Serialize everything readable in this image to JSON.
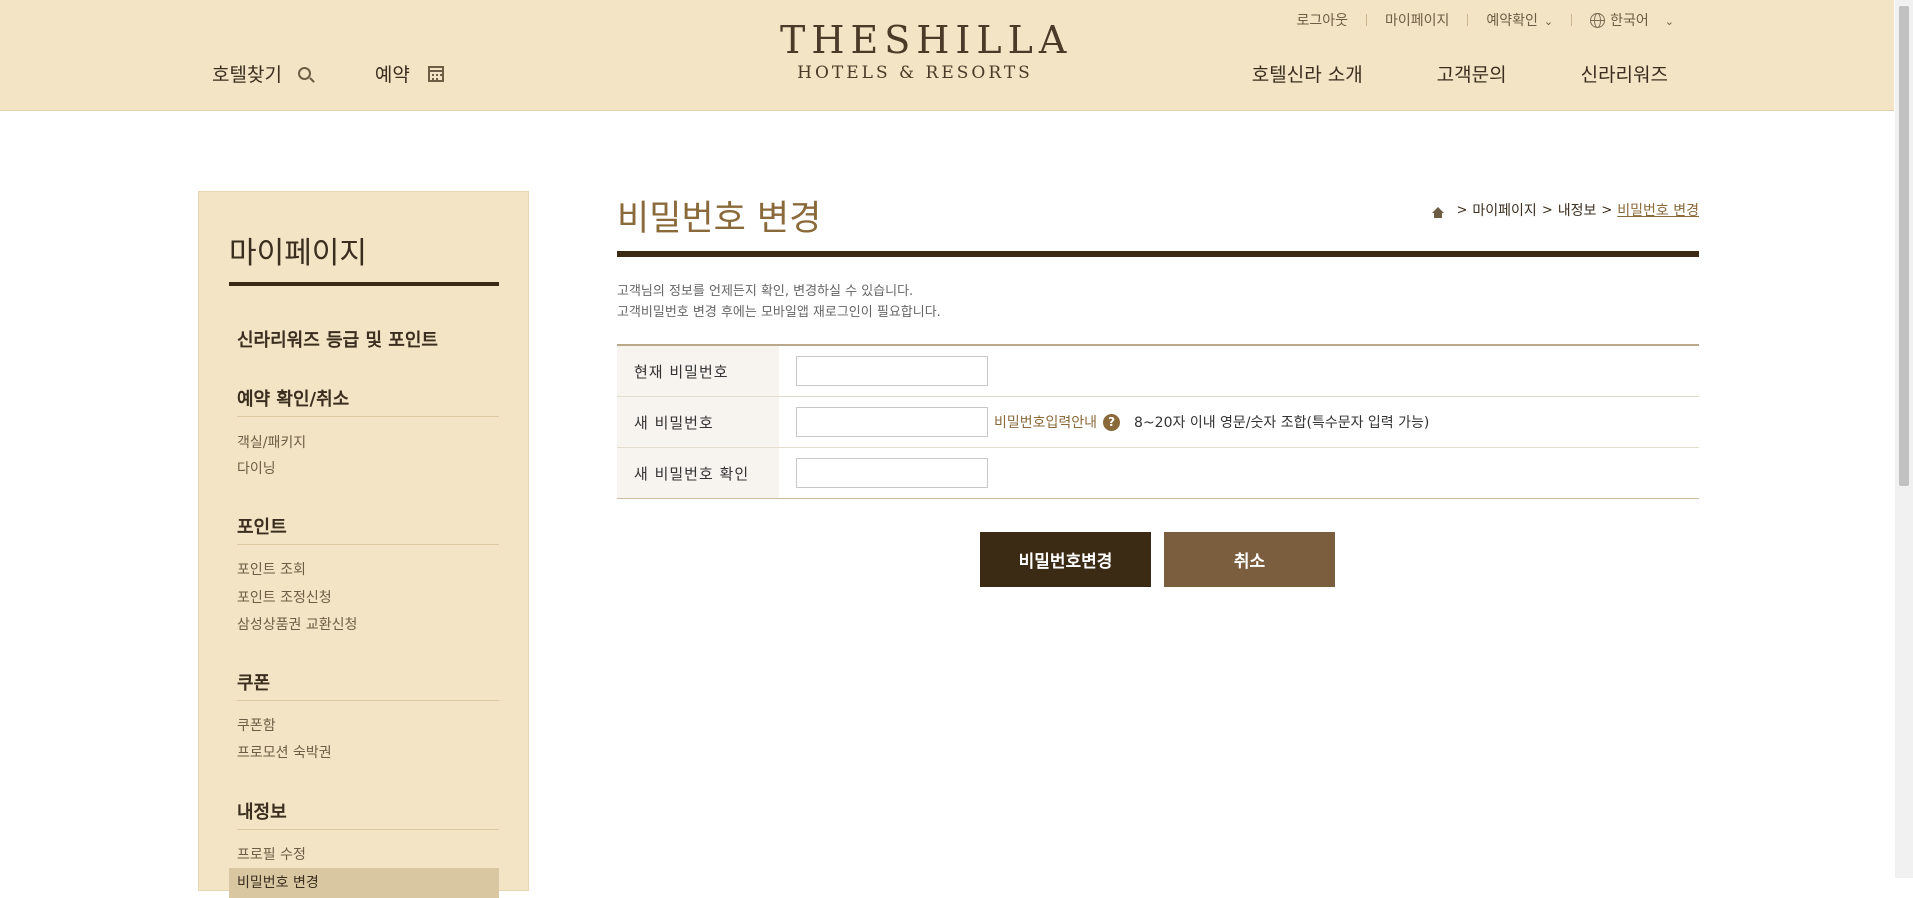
{
  "header": {
    "util": {
      "logout": "로그아웃",
      "mypage": "마이페이지",
      "reservation_check": "예약확인",
      "language": "한국어"
    },
    "nav_left": {
      "find_hotel": "호텔찾기",
      "reserve": "예약"
    },
    "logo": {
      "line1": "THESHILLA",
      "line2": "HOTELS & RESORTS"
    },
    "nav_right": [
      {
        "label": "호텔신라 소개"
      },
      {
        "label": "고객문의"
      },
      {
        "label": "신라리워즈"
      }
    ]
  },
  "sidebar": {
    "title": "마이페이지",
    "sections": [
      {
        "title": "신라리워즈 등급 및 포인트",
        "links": []
      },
      {
        "title": "예약 확인/취소",
        "links": [
          "객실/패키지",
          "다이닝"
        ]
      },
      {
        "title": "포인트",
        "links": [
          "포인트 조회",
          "포인트 조정신청",
          "삼성상품권 교환신청"
        ]
      },
      {
        "title": "쿠폰",
        "links": [
          "쿠폰함",
          "프로모션 숙박권"
        ]
      },
      {
        "title": "내정보",
        "links": [
          "프로필 수정",
          "비밀번호 변경"
        ]
      }
    ]
  },
  "main": {
    "title": "비밀번호 변경",
    "breadcrumb": [
      "마이페이지",
      "내정보",
      "비밀번호 변경"
    ],
    "description": [
      "고객님의 정보를 언제든지 확인, 변경하실 수 있습니다.",
      "고객비밀번호 변경 후에는 모바일앱 재로그인이 필요합니다."
    ],
    "form": {
      "current_password_label": "현재 비밀번호",
      "new_password_label": "새 비밀번호",
      "confirm_password_label": "새 비밀번호 확인",
      "guide_link": "비밀번호입력안내",
      "help_icon_glyph": "?",
      "guide_text": "8~20자 이내 영문/숫자 조합(특수문자 입력 가능)"
    },
    "buttons": {
      "submit": "비밀번호변경",
      "cancel": "취소"
    }
  },
  "colors": {
    "header_bg": "#f2e4c4",
    "dark_brown": "#3b2a14",
    "accent_brown": "#8a6a3a",
    "cancel_btn": "#7a5e3e"
  }
}
